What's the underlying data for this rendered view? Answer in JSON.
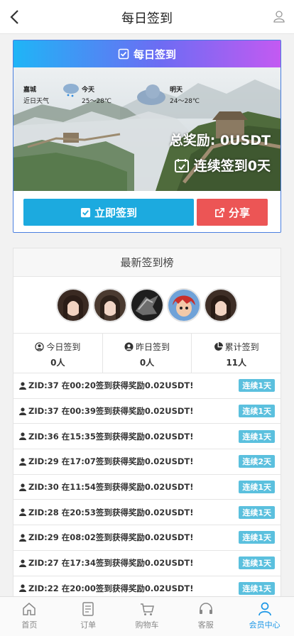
{
  "header": {
    "title": "每日签到"
  },
  "card": {
    "heading": "每日签到",
    "weather": {
      "city": "嘉城",
      "recent": "近日天气",
      "today_label": "今天",
      "today_temp": "25～28℃",
      "tomorrow_label": "明天",
      "tomorrow_temp": "24～28℃"
    },
    "total_reward": "总奖励: 0USDT",
    "streak": "连续签到0天",
    "sign_button": "立即签到",
    "share_button": "分享"
  },
  "ranking": {
    "title": "最新签到榜",
    "stats": [
      {
        "label": "今日签到",
        "value": "0人",
        "icon": "user-circle-icon"
      },
      {
        "label": "昨日签到",
        "value": "0人",
        "icon": "user-circle-icon"
      },
      {
        "label": "累计签到",
        "value": "11人",
        "icon": "pie-chart-icon"
      }
    ],
    "records": [
      {
        "text": "ZID:37 在00:20签到获得奖励0.02USDT!",
        "badge": "连续1天"
      },
      {
        "text": "ZID:37 在00:39签到获得奖励0.02USDT!",
        "badge": "连续1天"
      },
      {
        "text": "ZID:36 在15:35签到获得奖励0.02USDT!",
        "badge": "连续1天"
      },
      {
        "text": "ZID:29 在17:07签到获得奖励0.02USDT!",
        "badge": "连续2天"
      },
      {
        "text": "ZID:30 在11:54签到获得奖励0.02USDT!",
        "badge": "连续1天"
      },
      {
        "text": "ZID:28 在20:53签到获得奖励0.02USDT!",
        "badge": "连续1天"
      },
      {
        "text": "ZID:29 在08:02签到获得奖励0.02USDT!",
        "badge": "连续1天"
      },
      {
        "text": "ZID:27 在17:34签到获得奖励0.02USDT!",
        "badge": "连续1天"
      },
      {
        "text": "ZID:22 在20:00签到获得奖励0.02USDT!",
        "badge": "连续1天"
      }
    ]
  },
  "tabbar": {
    "items": [
      {
        "label": "首页",
        "icon": "home-icon"
      },
      {
        "label": "订单",
        "icon": "order-icon"
      },
      {
        "label": "购物车",
        "icon": "cart-icon"
      },
      {
        "label": "客服",
        "icon": "headset-icon"
      },
      {
        "label": "会员中心",
        "icon": "member-icon"
      }
    ],
    "active": "会员中心"
  },
  "colors": {
    "accent": "#1caadf",
    "share": "#ec5555",
    "badge": "#5bc0de",
    "active_tab": "#1a96e6"
  }
}
